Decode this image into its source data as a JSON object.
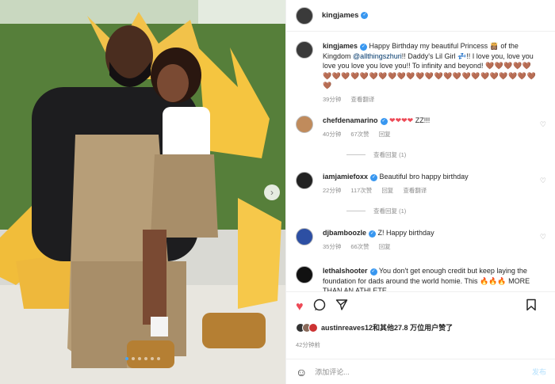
{
  "post": {
    "author": "kingjames",
    "caption_prefix": "Happy Birthday my beautiful Princess",
    "caption_mid": "of the Kingdom",
    "caption_mention": "@allthingszhuri",
    "caption_mid2": "!! Daddy's Lil Girl",
    "caption_suffix": "!! I love you, love you love you love you love you!! To infinity and beyond!",
    "caption_hearts": "🤎🤎🤎🤎🤎🤎🤎🤎🤎🤎🤎🤎🤎🤎🤎🤎🤎🤎🤎🤎🤎🤎🤎🤎🤎🤎🤎🤎🤎",
    "caption_time": "39分钟",
    "caption_translate": "查看翻译",
    "likes_text_user": "austinreaves12",
    "likes_text": "和其他27.8 万位用户赞了",
    "posted_time": "42分钟前"
  },
  "comments": [
    {
      "username": "chefdenamarino",
      "text": "ZZ!!!",
      "hearts": "❤❤❤❤",
      "time": "40分钟",
      "likes": "67次赞",
      "reply": "回复",
      "view_replies": "查看回复 (1)"
    },
    {
      "username": "iamjamiefoxx",
      "text": "Beautiful bro happy birthday",
      "time": "22分钟",
      "likes": "117次赞",
      "reply": "回复",
      "translate": "查看翻译",
      "view_replies": "查看回复 (1)"
    },
    {
      "username": "djbamboozle",
      "text": "Z! Happy birthday",
      "time": "35分钟",
      "likes": "66次赞",
      "reply": "回复"
    },
    {
      "username": "lethalshooter",
      "text": "You don't get enough credit but keep laying the foundation for dads around the world homie. This",
      "text_end": "MORE THAN AN ATHLETE",
      "fire": "🔥🔥🔥"
    }
  ],
  "add_comment": {
    "placeholder": "添加评论...",
    "post_label": "发布"
  },
  "carousel": {
    "total": 6,
    "active": 1
  },
  "colors": {
    "verified": "#3897f0",
    "like": "#ed4956",
    "link": "#00376b"
  }
}
